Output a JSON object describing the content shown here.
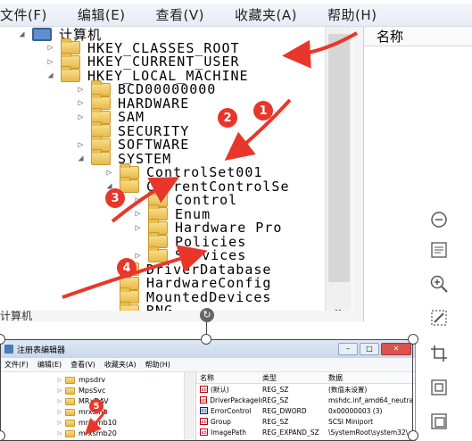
{
  "top_editor": {
    "menu": [
      "文件(F)",
      "编辑(E)",
      "查看(V)",
      "收藏夹(A)",
      "帮助(H)"
    ],
    "right_column_header": "名称",
    "tree": [
      {
        "label": "计算机",
        "depth": 0,
        "expander": "◢",
        "icon": "computer"
      },
      {
        "label": "HKEY_CLASSES_ROOT",
        "depth": 1,
        "expander": "▷",
        "icon": "folder"
      },
      {
        "label": "HKEY_CURRENT_USER",
        "depth": 1,
        "expander": "▷",
        "icon": "folder"
      },
      {
        "label": "HKEY_LOCAL_MACHINE",
        "depth": 1,
        "expander": "◢",
        "icon": "folder"
      },
      {
        "label": "BCD00000000",
        "depth": 2,
        "expander": "▷",
        "icon": "folder"
      },
      {
        "label": "HARDWARE",
        "depth": 2,
        "expander": "▷",
        "icon": "folder"
      },
      {
        "label": "SAM",
        "depth": 2,
        "expander": "▷",
        "icon": "folder"
      },
      {
        "label": "SECURITY",
        "depth": 2,
        "expander": "",
        "icon": "folder"
      },
      {
        "label": "SOFTWARE",
        "depth": 2,
        "expander": "▷",
        "icon": "folder"
      },
      {
        "label": "SYSTEM",
        "depth": 2,
        "expander": "◢",
        "icon": "folder"
      },
      {
        "label": "ControlSet001",
        "depth": 3,
        "expander": "▷",
        "icon": "folder"
      },
      {
        "label": "CurrentControlSe",
        "depth": 3,
        "expander": "◢",
        "icon": "folder"
      },
      {
        "label": "Control",
        "depth": 4,
        "expander": "▷",
        "icon": "folder"
      },
      {
        "label": "Enum",
        "depth": 4,
        "expander": "▷",
        "icon": "folder"
      },
      {
        "label": "Hardware Pro",
        "depth": 4,
        "expander": "▷",
        "icon": "folder"
      },
      {
        "label": "Policies",
        "depth": 4,
        "expander": "",
        "icon": "folder"
      },
      {
        "label": "Services",
        "depth": 4,
        "expander": "▷",
        "icon": "folder"
      },
      {
        "label": "DriverDatabase",
        "depth": 3,
        "expander": "",
        "icon": "folder"
      },
      {
        "label": "HardwareConfig",
        "depth": 3,
        "expander": "",
        "icon": "folder"
      },
      {
        "label": "MountedDevices",
        "depth": 3,
        "expander": "",
        "icon": "folder"
      },
      {
        "label": "RNG",
        "depth": 3,
        "expander": "",
        "icon": "folder"
      }
    ],
    "status": "计算机",
    "scroll_down_glyph": "⌄"
  },
  "annotations": [
    {
      "number": "1"
    },
    {
      "number": "2"
    },
    {
      "number": "3"
    },
    {
      "number": "4"
    },
    {
      "number": "5"
    }
  ],
  "bottom_editor": {
    "title": "注册表编辑器",
    "window_buttons": [
      "–",
      "□",
      "✕"
    ],
    "menu": [
      "文件(F)",
      "编辑(E)",
      "查看(V)",
      "收藏夹(A)",
      "帮助(H)"
    ],
    "tree": [
      {
        "label": "mpsdrv"
      },
      {
        "label": "MpsSvc"
      },
      {
        "label": "MRxDAV"
      },
      {
        "label": "mrxsmb"
      },
      {
        "label": "mrxsmb10"
      },
      {
        "label": "mrxsmb20"
      }
    ],
    "columns": [
      "名称",
      "类型",
      "数据"
    ],
    "rows": [
      {
        "name": "(默认)",
        "type": "REG_SZ",
        "data": "(数值未设置)",
        "icon": "string"
      },
      {
        "name": "DriverPackageId",
        "type": "REG_SZ",
        "data": "mshdc.inf_amd64_neutra",
        "icon": "string"
      },
      {
        "name": "ErrorControl",
        "type": "REG_DWORD",
        "data": "0x00000003 (3)",
        "icon": "binary"
      },
      {
        "name": "Group",
        "type": "REG_SZ",
        "data": "SCSI Miniport",
        "icon": "string"
      },
      {
        "name": "ImagePath",
        "type": "REG_EXPAND_SZ",
        "data": "\\SystemRoot\\system32\\",
        "icon": "string"
      }
    ]
  },
  "colors": {
    "annotation_red": "#e8372a",
    "folder_yellow": "#e8b94a"
  },
  "toolbar_icons": [
    "zoom-out-icon",
    "text-layout-icon",
    "zoom-in-icon",
    "magic-wand-icon",
    "crop-icon",
    "fit-icon",
    "ocr-icon"
  ]
}
